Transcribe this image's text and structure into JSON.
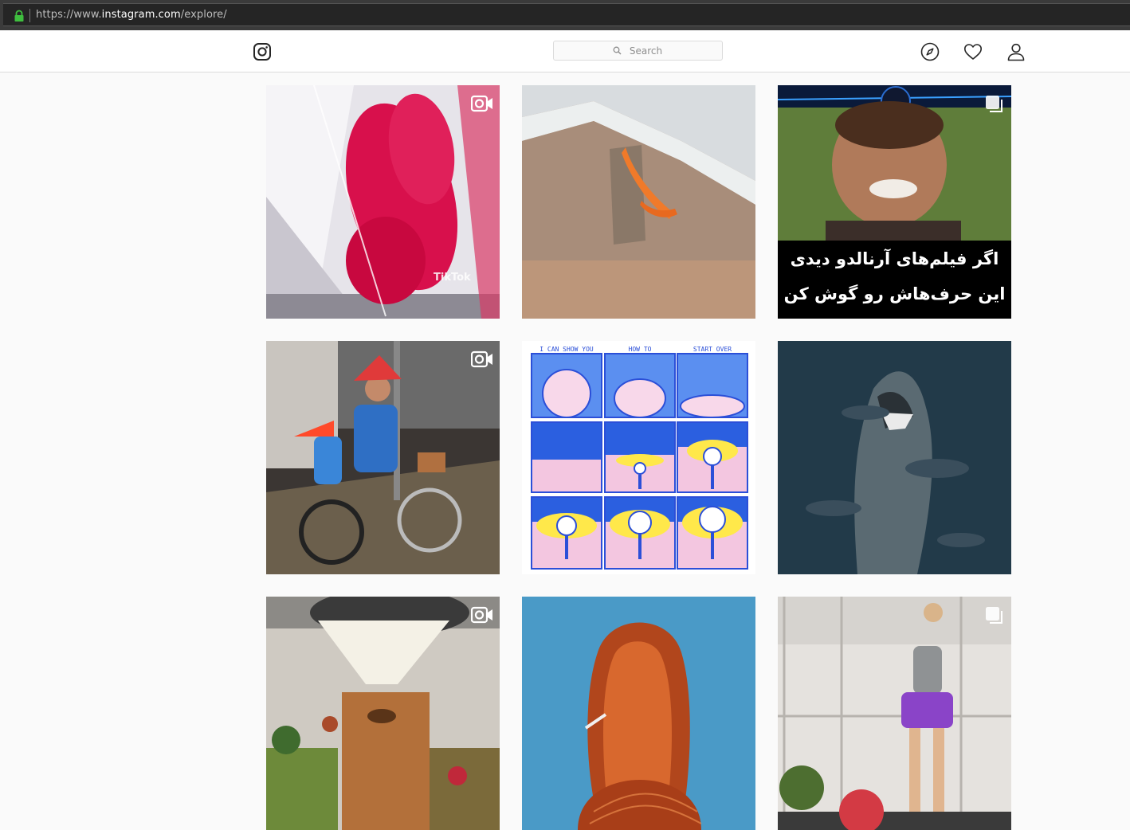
{
  "browser": {
    "url_prefix": "https://www.",
    "url_host": "instagram.com",
    "url_path": "/explore/"
  },
  "search": {
    "placeholder": "Search"
  },
  "icons": {
    "logo": "instagram-logo-icon",
    "explore": "compass-icon",
    "activity": "heart-icon",
    "profile": "person-icon"
  },
  "posts": [
    {
      "type": "video",
      "description_badge": "video-camera-icon",
      "overlay_text": "TikTok"
    },
    {
      "type": "photo"
    },
    {
      "type": "carousel",
      "description_badge": "carousel-icon",
      "overlay_line1": "اگر فیلم‌های آرنالدو دیدی",
      "overlay_line2": "این حرف‌هاش رو گوش کن"
    },
    {
      "type": "video",
      "description_badge": "video-camera-icon"
    },
    {
      "type": "photo",
      "comic_labels": [
        "I CAN SHOW YOU",
        "HOW TO",
        "START OVER"
      ]
    },
    {
      "type": "photo"
    },
    {
      "type": "video",
      "description_badge": "video-camera-icon"
    },
    {
      "type": "photo"
    },
    {
      "type": "carousel",
      "description_badge": "carousel-icon"
    }
  ],
  "colors": {
    "background": "#fafafa",
    "header_border": "#dbdbdb",
    "icon": "#262626"
  }
}
